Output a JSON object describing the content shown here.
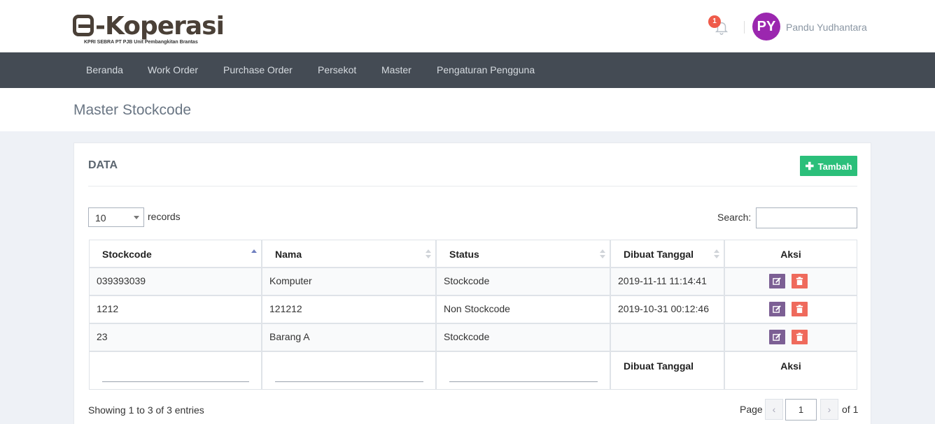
{
  "header": {
    "logo_text": "-Koperasi",
    "logo_subtitle": "KPRI SEBRA PT PJB Unit Pembangkitan Brantas",
    "notification_count": "1",
    "avatar_initials": "PY",
    "avatar_color": "#9b27af",
    "user_name": "Pandu Yudhantara"
  },
  "nav": {
    "items": [
      {
        "label": "Beranda"
      },
      {
        "label": "Work Order"
      },
      {
        "label": "Purchase Order"
      },
      {
        "label": "Persekot"
      },
      {
        "label": "Master"
      },
      {
        "label": "Pengaturan Pengguna"
      }
    ]
  },
  "page": {
    "title": "Master Stockcode"
  },
  "card": {
    "title": "DATA",
    "add_button": "Tambah",
    "length_value": "10",
    "records_label": "records",
    "search_label": "Search:",
    "search_value": ""
  },
  "table": {
    "columns": [
      "Stockcode",
      "Nama",
      "Status",
      "Dibuat Tanggal",
      "Aksi"
    ],
    "rows": [
      {
        "stockcode": "039393039",
        "nama": "Komputer",
        "status": "Stockcode",
        "created": "2019-11-11 11:14:41"
      },
      {
        "stockcode": "1212",
        "nama": "121212",
        "status": "Non Stockcode",
        "created": "2019-10-31 00:12:46"
      },
      {
        "stockcode": "23",
        "nama": "Barang A",
        "status": "Stockcode",
        "created": ""
      }
    ],
    "footer": {
      "created": "Dibuat Tanggal",
      "aksi": "Aksi"
    }
  },
  "pagination": {
    "info": "Showing 1 to 3 of 3 entries",
    "page_label": "Page",
    "current_page": "1",
    "of_label": "of 1",
    "prev": "‹",
    "next": "›"
  },
  "colors": {
    "accent_green": "#2bbf7a",
    "nav_bg": "#444b54",
    "edit": "#7c5f94",
    "delete": "#ef6a5c"
  }
}
